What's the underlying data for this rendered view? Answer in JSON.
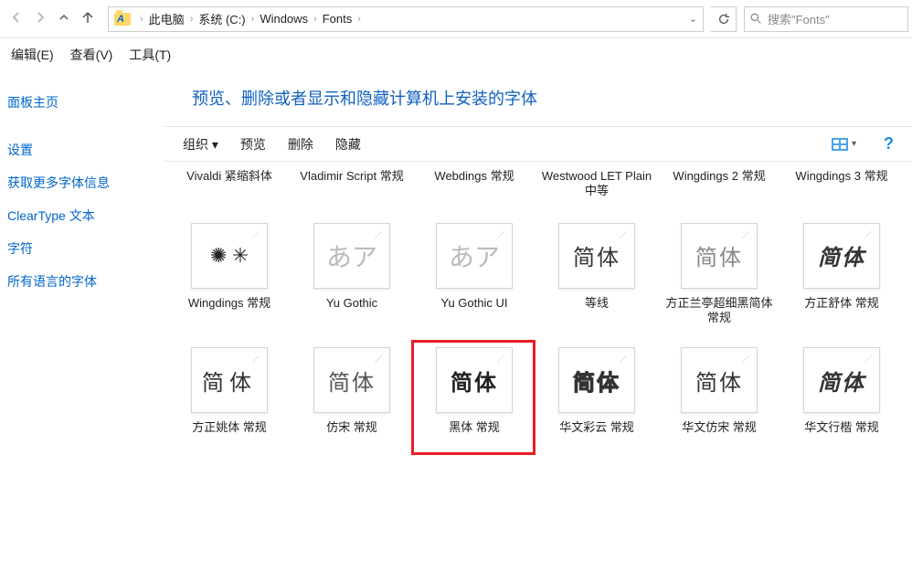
{
  "breadcrumb": {
    "p1": "此电脑",
    "p2": "系统 (C:)",
    "p3": "Windows",
    "p4": "Fonts"
  },
  "search": {
    "placeholder": "搜索\"Fonts\""
  },
  "menubar": {
    "edit": "编辑(E)",
    "view": "查看(V)",
    "tools": "工具(T)"
  },
  "sidebar": {
    "home": "面板主页",
    "items": [
      "设置",
      "获取更多字体信息",
      "ClearType 文本",
      "字符",
      "所有语言的字体"
    ]
  },
  "heading": "预览、删除或者显示和隐藏计算机上安装的字体",
  "toolbar": {
    "org": "组织 ▾",
    "preview": "预览",
    "delete": "删除",
    "hide": "隐藏"
  },
  "fonts": {
    "r1": [
      {
        "label": "Vivaldi 紧缩斜体"
      },
      {
        "label": "Vladimir Script 常规"
      },
      {
        "label": "Webdings 常规"
      },
      {
        "label": "Westwood LET Plain 中等"
      },
      {
        "label": "Wingdings 2 常规"
      },
      {
        "label": "Wingdings 3 常规"
      }
    ],
    "r2": [
      {
        "label": "Wingdings 常规",
        "glyph": "✺ ✳"
      },
      {
        "label": "Yu Gothic",
        "glyph": "あア"
      },
      {
        "label": "Yu Gothic UI",
        "glyph": "あア"
      },
      {
        "label": "等线",
        "glyph": "简体"
      },
      {
        "label": "方正兰亭超细黑简体 常规",
        "glyph": "简体"
      },
      {
        "label": "方正舒体 常规",
        "glyph": "简体"
      }
    ],
    "r3": [
      {
        "label": "方正姚体 常规",
        "glyph": "简体"
      },
      {
        "label": "仿宋 常规",
        "glyph": "简体"
      },
      {
        "label": "黑体 常规",
        "glyph": "简体"
      },
      {
        "label": "华文彩云 常规",
        "glyph": "简体"
      },
      {
        "label": "华文仿宋 常规",
        "glyph": "简体"
      },
      {
        "label": "华文行楷 常规",
        "glyph": "简体"
      }
    ]
  }
}
